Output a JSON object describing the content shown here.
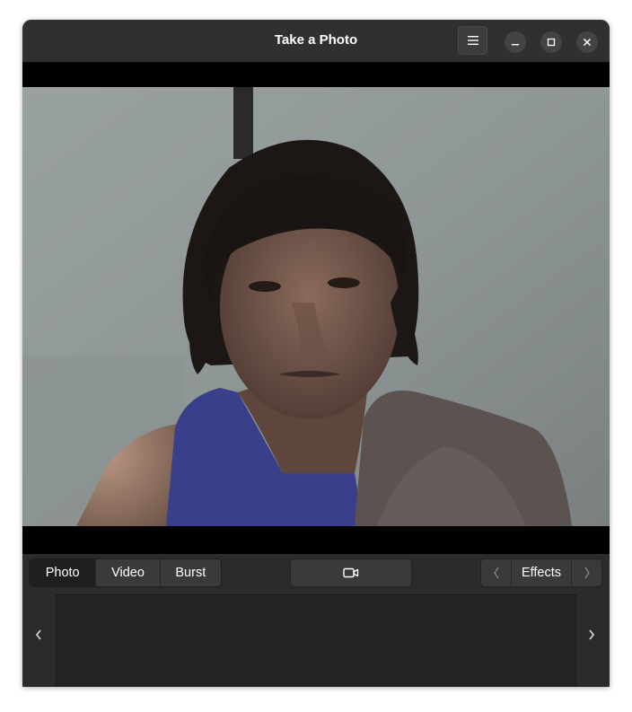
{
  "window": {
    "title": "Take a Photo",
    "buttons": {
      "menu": "hamburger-menu-icon",
      "minimize": "minimize-icon",
      "maximize": "maximize-icon",
      "close": "close-icon"
    }
  },
  "toolbar": {
    "modes": [
      {
        "label": "Photo",
        "active": true
      },
      {
        "label": "Video",
        "active": false
      },
      {
        "label": "Burst",
        "active": false
      }
    ],
    "capture_icon": "video-camera-icon",
    "effects_label": "Effects",
    "effects_prev_icon": "chevron-left-icon",
    "effects_next_icon": "chevron-right-icon"
  },
  "gallery": {
    "prev_icon": "chevron-left-icon",
    "next_icon": "chevron-right-icon"
  },
  "colors": {
    "window_bg": "#2b2b2b",
    "titlebar_bg": "#303030",
    "viewer_bg": "#000000",
    "active_mode_bg": "#1f1f1f"
  }
}
